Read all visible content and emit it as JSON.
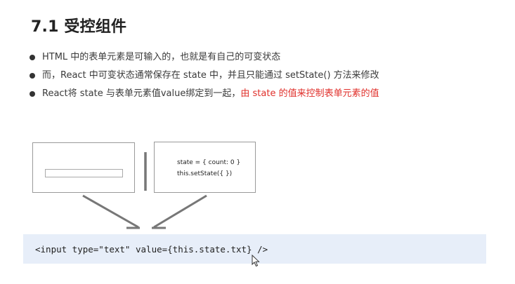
{
  "slide": {
    "title": "7.1 受控组件"
  },
  "bullets": [
    {
      "text": "HTML 中的表单元素是可输入的，也就是有自己的可变状态",
      "highlight": ""
    },
    {
      "text": "而，React 中可变状态通常保存在 state 中，并且只能通过 setState() 方法来修改",
      "highlight": ""
    },
    {
      "text": "React将 state 与表单元素值value绑定到一起，",
      "highlight": "由 state 的值来控制表单元素的值"
    }
  ],
  "diagram": {
    "state_line": "state = { count: 0 }",
    "setstate_line": "this.setState({     })"
  },
  "code": "<input type=\"text\" value={this.state.txt} />",
  "colors": {
    "highlight": "#e0302b",
    "code_panel_bg": "#e7eef9",
    "arrow": "#777777"
  },
  "icons": [
    "bullet-dot-icon",
    "mouse-cursor-icon"
  ]
}
